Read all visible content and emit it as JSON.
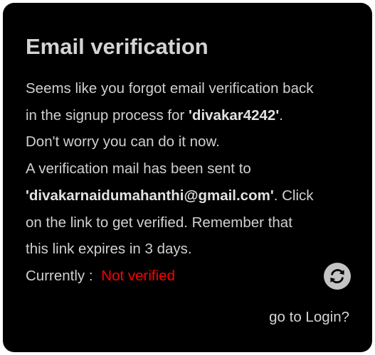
{
  "card": {
    "title": "Email verification",
    "line1": "Seems like you forgot email verification back",
    "line2_prefix": "in the signup process for ",
    "username": "'divakar4242'",
    "line2_suffix": ".",
    "line3": "Don't worry you can do it now.",
    "line4": "A verification mail has been sent to",
    "email": "'divakarnaidumahanthi@gmail.com'",
    "line5_suffix": ". Click",
    "line6": "on the link to get verified. Remember that",
    "line7": "this link expires in 3 days."
  },
  "status": {
    "label": "Currently :",
    "value": "Not verified",
    "value_color": "#ff0000"
  },
  "refresh": {
    "icon": "refresh-icon"
  },
  "login": {
    "label": "go to Login?"
  }
}
